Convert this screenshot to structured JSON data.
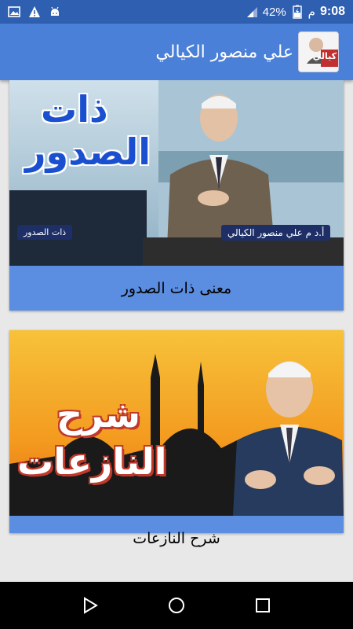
{
  "status_bar": {
    "time": "9:08",
    "time_suffix": "م",
    "battery": "42%"
  },
  "app_bar": {
    "title": "علي منصور الكيالي",
    "logo_text": "كيالي"
  },
  "videos": [
    {
      "title": "معنى ذات الصدور",
      "thumb_title_line1": "ذات",
      "thumb_title_line2": "الصدور",
      "thumb_caption_left": "ذات الصدور",
      "thumb_caption_right": "أ.د م علي منصور الكيالي"
    },
    {
      "title": "شرح النازعات",
      "thumb_title_line1": "شرح",
      "thumb_title_line2": "النازعات"
    }
  ],
  "colors": {
    "status_bar": "#2f5fb0",
    "app_bar": "#4a80d8",
    "card": "#5b8ee0"
  }
}
